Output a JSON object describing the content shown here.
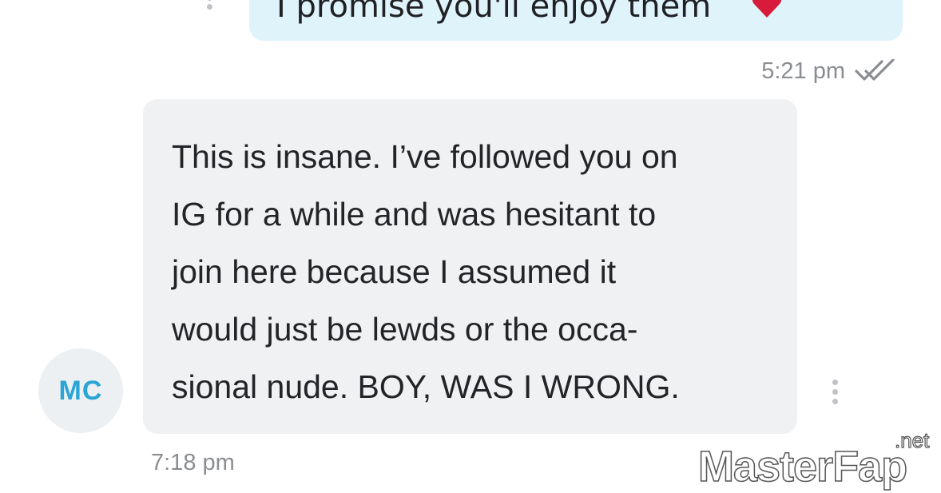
{
  "sent_message": {
    "text": "I promise you'll enjoy them",
    "time": "5:21 pm",
    "status_icon": "double-check-icon",
    "emoji_icon": "heart-icon"
  },
  "received_message": {
    "lines": [
      "This is insane. I’ve followed you on",
      "IG for a while and was hesitant to",
      "join here because I assumed it",
      "would just be lewds or the occa-",
      "sional nude. BOY, WAS I WRONG."
    ],
    "time": "7:18 pm",
    "sender_initials": "MC"
  },
  "watermark": {
    "text": "MasterFap",
    "suffix": ".net"
  },
  "colors": {
    "sent_bubble": "#dff3fb",
    "received_bubble": "#eff1f2",
    "avatar_text": "#2aa5d6",
    "avatar_bg": "#edf0f2",
    "heart": "#d81b3a",
    "watermark_accent": "#e8318a"
  }
}
